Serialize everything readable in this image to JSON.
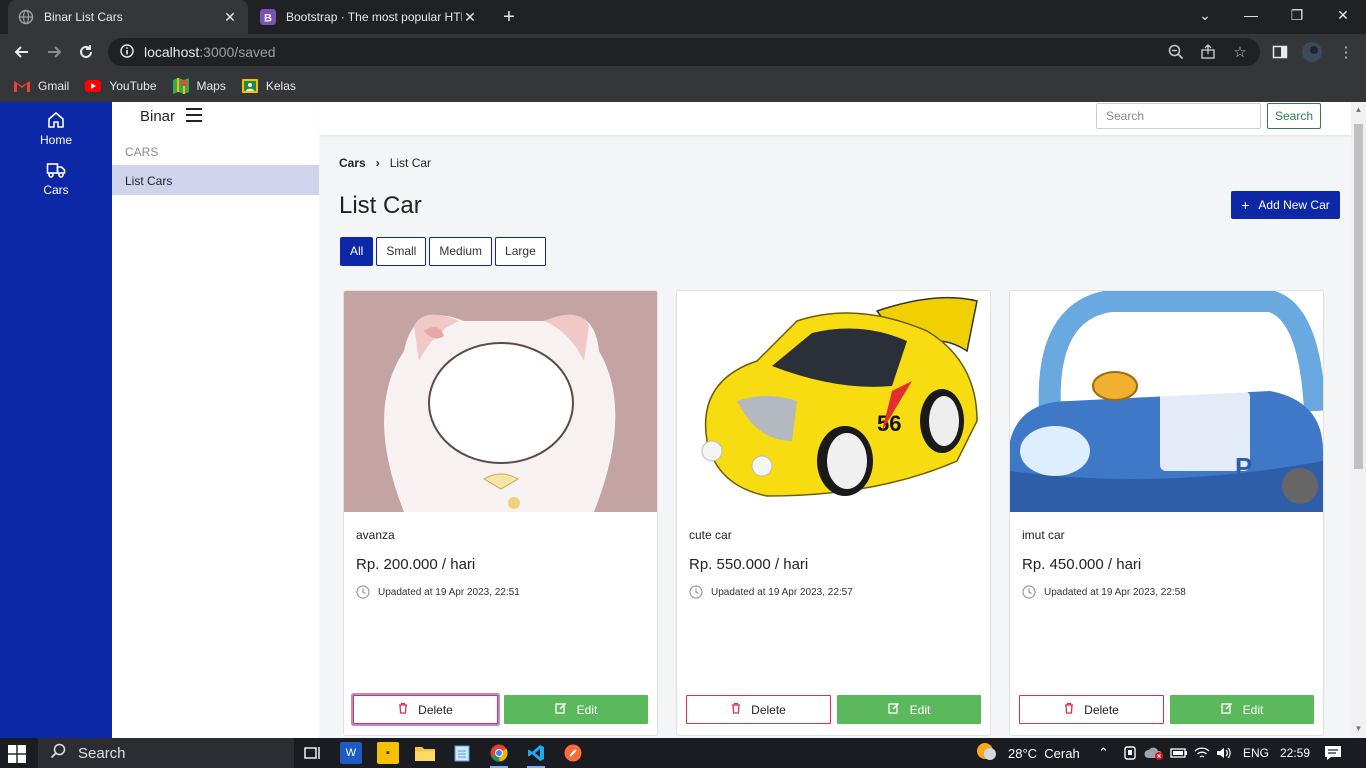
{
  "browser": {
    "tabs": [
      {
        "title": "Binar List Cars",
        "active": true
      },
      {
        "title": "Bootstrap · The most popular HTML",
        "active": false
      }
    ],
    "url_host": "localhost",
    "url_path": ":3000/saved",
    "bookmarks": [
      {
        "label": "Gmail",
        "icon": "gmail-icon"
      },
      {
        "label": "YouTube",
        "icon": "youtube-icon"
      },
      {
        "label": "Maps",
        "icon": "maps-icon"
      },
      {
        "label": "Kelas",
        "icon": "kelas-icon"
      }
    ]
  },
  "rail": {
    "items": [
      {
        "label": "Home",
        "icon": "home-icon"
      },
      {
        "label": "Cars",
        "icon": "truck-icon"
      }
    ]
  },
  "sidebar": {
    "brand": "Binar",
    "section": "CARS",
    "items": [
      {
        "label": "List Cars",
        "active": true
      }
    ]
  },
  "topbar": {
    "search_placeholder": "Search",
    "search_button": "Search"
  },
  "breadcrumb": {
    "parent": "Cars",
    "current": "List Car"
  },
  "main": {
    "title": "List Car",
    "add_button": "Add New Car",
    "filters": [
      {
        "label": "All",
        "active": true
      },
      {
        "label": "Small",
        "active": false
      },
      {
        "label": "Medium",
        "active": false
      },
      {
        "label": "Large",
        "active": false
      }
    ],
    "delete_label": "Delete",
    "edit_label": "Edit",
    "cars": [
      {
        "name": "avanza",
        "price": "Rp. 200.000 / hari",
        "updated": "Upadated at 19 Apr 2023, 22:51"
      },
      {
        "name": "cute car",
        "price": "Rp. 550.000 / hari",
        "updated": "Upadated at 19 Apr 2023, 22:57"
      },
      {
        "name": "imut car",
        "price": "Rp. 450.000 / hari",
        "updated": "Upadated at 19 Apr 2023, 22:58"
      }
    ]
  },
  "taskbar": {
    "search_label": "Search",
    "weather": "28°C  Cerah",
    "language": "ENG",
    "time": "22:59"
  },
  "colors": {
    "primary": "#0d28a6",
    "success": "#5cb85c",
    "danger": "#d6344a",
    "sidebar_active": "#cfd4ed"
  }
}
